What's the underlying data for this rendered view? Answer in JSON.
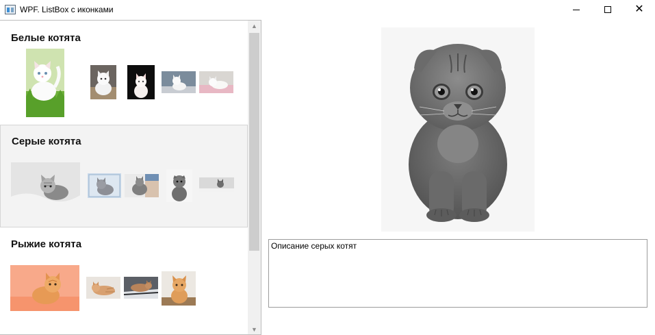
{
  "window": {
    "title": "WPF. ListBox с иконками"
  },
  "list": {
    "groups": [
      {
        "title": "Белые котята",
        "selected": false
      },
      {
        "title": "Серые котята",
        "selected": true
      },
      {
        "title": "Рыжие котята",
        "selected": false
      }
    ]
  },
  "description": {
    "text": "Описание серых котят"
  },
  "colors": {
    "selection_background": "#f3f3f3",
    "scroll_thumb": "#cdcdcd"
  }
}
